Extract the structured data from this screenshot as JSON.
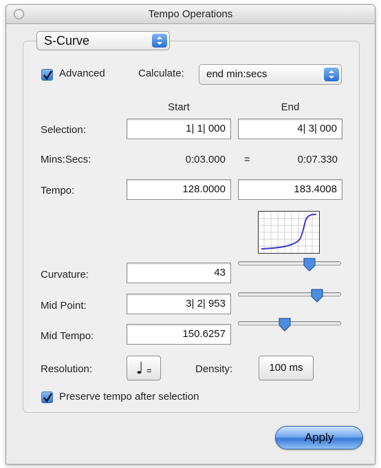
{
  "window": {
    "title": "Tempo Operations"
  },
  "mode": {
    "selected": "S-Curve"
  },
  "advanced": {
    "label": "Advanced",
    "checked": true
  },
  "calculate": {
    "label": "Calculate:",
    "selected": "end min:secs"
  },
  "columns": {
    "start": "Start",
    "end": "End"
  },
  "selection": {
    "label": "Selection:",
    "start": "1| 1| 000",
    "end": "4| 3| 000"
  },
  "minsecs": {
    "label": "Mins:Secs:",
    "start": "0:03.000",
    "separator": "=",
    "end": "0:07.330"
  },
  "tempo": {
    "label": "Tempo:",
    "start": "128.0000",
    "end": "183.4008"
  },
  "curvature": {
    "label": "Curvature:",
    "value": "43"
  },
  "midpoint": {
    "label": "Mid Point:",
    "value": "3| 2| 953"
  },
  "midtempo": {
    "label": "Mid Tempo:",
    "value": "150.6257"
  },
  "resolution": {
    "label": "Resolution:",
    "note_symbol": "♩",
    "equals": "="
  },
  "density": {
    "label": "Density:",
    "value": "100 ms"
  },
  "preserve": {
    "label": "Preserve tempo after selection",
    "checked": true
  },
  "apply": {
    "label": "Apply"
  },
  "colors": {
    "accent": "#3a7ad8",
    "curve": "#3a3ad0"
  }
}
